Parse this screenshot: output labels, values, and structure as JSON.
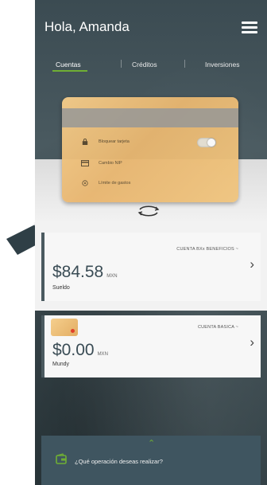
{
  "header": {
    "greeting": "Hola, Amanda",
    "menu_icon": "hamburger-menu-icon"
  },
  "tabs": [
    {
      "label": "Cuentas",
      "active": true
    },
    {
      "label": "Créditos",
      "active": false
    },
    {
      "label": "Inversiones",
      "active": false
    }
  ],
  "card_options": [
    {
      "label": "Bloquear tarjeta",
      "icon": "lock-icon"
    },
    {
      "label": "Cambio NIP",
      "icon": "card-icon"
    },
    {
      "label": "Límite de gastos",
      "icon": "limit-icon"
    }
  ],
  "accounts": [
    {
      "name": "CUENTA BXx BENEFICIOS ~",
      "amount": "$84.58",
      "currency": "MXN",
      "sub": "Sueldo"
    },
    {
      "name": "CUENTA BASICA ~",
      "amount": "$0.00",
      "currency": "MXN",
      "sub": "Mundy"
    }
  ],
  "bottom": {
    "question": "¿Qué operación deseas realizar?"
  },
  "colors": {
    "accent": "#6fae34",
    "header_bg": "#3b4b52",
    "card_gold": "#e8b670"
  }
}
